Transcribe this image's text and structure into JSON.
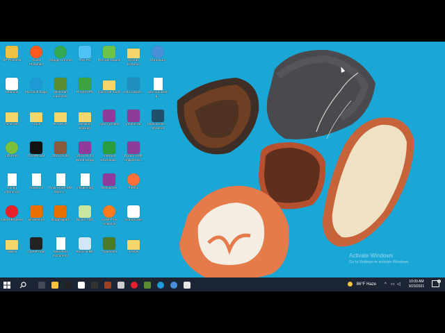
{
  "desktop": {
    "icons": [
      {
        "label": "HP ProDesk",
        "icon": "user-folder-icon",
        "color": "#f0c040"
      },
      {
        "label": "Vitamins",
        "icon": "usb-icon",
        "color": "#ffffff"
      },
      {
        "label": "minecraft",
        "icon": "folder-icon",
        "color": "#f5d66b"
      },
      {
        "label": "uTorrent",
        "icon": "utorrent-icon",
        "color": "#7bbf3a"
      },
      {
        "label": "Config phone.txt",
        "icon": "text-file-icon",
        "color": "#ffffff"
      },
      {
        "label": "Opera Browser",
        "icon": "opera-icon",
        "color": "#e8212b"
      },
      {
        "label": "Videos",
        "icon": "folder-icon",
        "color": "#f5d66b"
      },
      {
        "label": "Avast Presenter",
        "icon": "avast-icon",
        "color": "#ff5a1f"
      },
      {
        "label": "Microsoft Edge",
        "icon": "edge-icon",
        "color": "#1f9ad6"
      },
      {
        "label": "ArtLib",
        "icon": "folder-icon",
        "color": "#f5d66b"
      },
      {
        "label": "7z1900-x64",
        "icon": "7zip-icon",
        "color": "#111111"
      },
      {
        "label": "Adobe.txt",
        "icon": "text-file-icon",
        "color": "#ffffff"
      },
      {
        "label": "windeed.jre",
        "icon": "java-icon",
        "color": "#e76f00"
      },
      {
        "label": "CurseForge",
        "icon": "curseforge-icon",
        "color": "#222222"
      },
      {
        "label": "Google Chrome",
        "icon": "chrome-icon",
        "color": "#34a853"
      },
      {
        "label": "Minecraft Launcher",
        "icon": "minecraft-icon",
        "color": "#5b8c32"
      },
      {
        "label": "BACKUP",
        "icon": "folder-icon",
        "color": "#f5d66b"
      },
      {
        "label": "2021 01 26",
        "icon": "image-icon",
        "color": "#8a5a3a"
      },
      {
        "label": "Final report MM 2021.x...",
        "icon": "text-file-icon",
        "color": "#ffffff"
      },
      {
        "label": "blogprogram",
        "icon": "java-icon",
        "color": "#e76f00"
      },
      {
        "label": "New Text Document",
        "icon": "text-file-icon",
        "color": "#ffffff"
      },
      {
        "label": "This PC",
        "icon": "this-pc-icon",
        "color": "#4fc3f7"
      },
      {
        "label": "ProtonVPN",
        "icon": "protonvpn-icon",
        "color": "#3ea33e"
      },
      {
        "label": "Desktop Backup",
        "icon": "folder-icon",
        "color": "#f5d66b"
      },
      {
        "label": "2021 03 24 World Setup",
        "icon": "winrar-icon",
        "color": "#8e3c9c"
      },
      {
        "label": "installer.log",
        "icon": "text-file-icon",
        "color": "#ffffff"
      },
      {
        "label": "Bloom TDX",
        "icon": "document-icon",
        "color": "#c8e6a0"
      },
      {
        "label": "Recycle Bin",
        "icon": "recycle-bin-icon",
        "color": "#d0e8f5"
      },
      {
        "label": "Remote Mouse",
        "icon": "remote-mouse-icon",
        "color": "#6cc24a"
      },
      {
        "label": "minecraft mods",
        "icon": "folder-icon",
        "color": "#f5d66b"
      },
      {
        "label": "Ajan's project",
        "icon": "winrar-icon",
        "color": "#8e3c9c"
      },
      {
        "label": "Internet Download...",
        "icon": "idm-icon",
        "color": "#2a9d3c"
      },
      {
        "label": "Resources",
        "icon": "winrar-icon",
        "color": "#8e3c9c"
      },
      {
        "label": "Avast Free Antivirus",
        "icon": "avast-icon",
        "color": "#ff7a1f"
      },
      {
        "label": "TLauncher",
        "icon": "tlauncher-icon",
        "color": "#4a7a2a"
      },
      {
        "label": "smooth Extreme",
        "icon": "folder-icon",
        "color": "#f5d66b"
      },
      {
        "label": "Auto Clicker...",
        "icon": "mouse-icon",
        "color": "#1f8fbf"
      },
      {
        "label": "iphone.rar",
        "icon": "winrar-icon",
        "color": "#8e3c9c"
      },
      {
        "label": "Dream SMP Original Sk...",
        "icon": "winrar-icon",
        "color": "#8e3c9c"
      },
      {
        "label": "Firefox",
        "icon": "firefox-icon",
        "color": "#ff7139"
      },
      {
        "label": "VideoScribe",
        "icon": "play-icon",
        "color": "#ffffff"
      },
      {
        "label": "JAVQs",
        "icon": "folder-icon",
        "color": "#f5d66b"
      },
      {
        "label": "Chromium",
        "icon": "chromium-icon",
        "color": "#4a90d9"
      },
      {
        "label": "List of publish d...",
        "icon": "docx-icon",
        "color": "#ffffff"
      },
      {
        "label": "Shotcut ele... - Shortcut",
        "icon": "shotcut-icon",
        "color": "#1f4f6b"
      }
    ]
  },
  "watermark": {
    "title": "Activate Windows",
    "subtitle": "Go to Settings to activate Windows."
  },
  "taskbar": {
    "start_icon": "windows-start-icon",
    "search_icon": "search-icon",
    "pinned": [
      {
        "icon": "task-view-icon",
        "color": "#444c5a"
      },
      {
        "icon": "file-explorer-icon",
        "color": "#f5c242"
      },
      {
        "icon": "pubg-icon",
        "color": "#222222"
      },
      {
        "icon": "notepad-icon",
        "color": "#ffffff"
      },
      {
        "icon": "terminal-icon",
        "color": "#333333"
      },
      {
        "icon": "photo-icon",
        "color": "#a04020"
      },
      {
        "icon": "settings-icon",
        "color": "#cccccc"
      },
      {
        "icon": "opera-icon",
        "color": "#e8212b"
      },
      {
        "icon": "minecraft-icon",
        "color": "#5b8c32"
      },
      {
        "icon": "edge-icon",
        "color": "#1f9ad6"
      },
      {
        "icon": "chromium-icon",
        "color": "#4a90d9"
      },
      {
        "icon": "app-icon",
        "color": "#e6e6e6"
      }
    ],
    "weather": "86°F Haze",
    "time": "10:09 AM",
    "date": "9/23/2021",
    "notification_count": "1"
  }
}
